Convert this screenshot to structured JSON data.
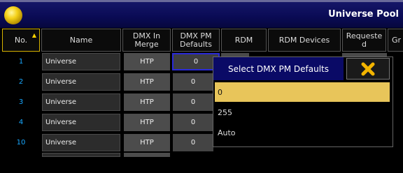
{
  "window": {
    "title": "Universe Pool"
  },
  "columns": [
    "No.",
    "Name",
    "DMX In\nMerge",
    "DMX PM\nDefaults",
    "RDM",
    "RDM Devices",
    "Requeste\nd",
    "Gr"
  ],
  "rows": [
    {
      "no": "1",
      "name": "Universe",
      "merge": "HTP",
      "pm": "0"
    },
    {
      "no": "2",
      "name": "Universe",
      "merge": "HTP",
      "pm": "0"
    },
    {
      "no": "3",
      "name": "Universe",
      "merge": "HTP",
      "pm": "0"
    },
    {
      "no": "4",
      "name": "Universe",
      "merge": "HTP",
      "pm": "0"
    },
    {
      "no": "10",
      "name": "Universe",
      "merge": "HTP",
      "pm": "0"
    }
  ],
  "popup": {
    "title": "Select DMX PM Defaults",
    "options": [
      "0",
      "255",
      "Auto"
    ],
    "selected_index": 0
  },
  "colors": {
    "accent": "#e8c55a",
    "titlebar": "#0a0b55",
    "row_number": "#18a8ff"
  }
}
